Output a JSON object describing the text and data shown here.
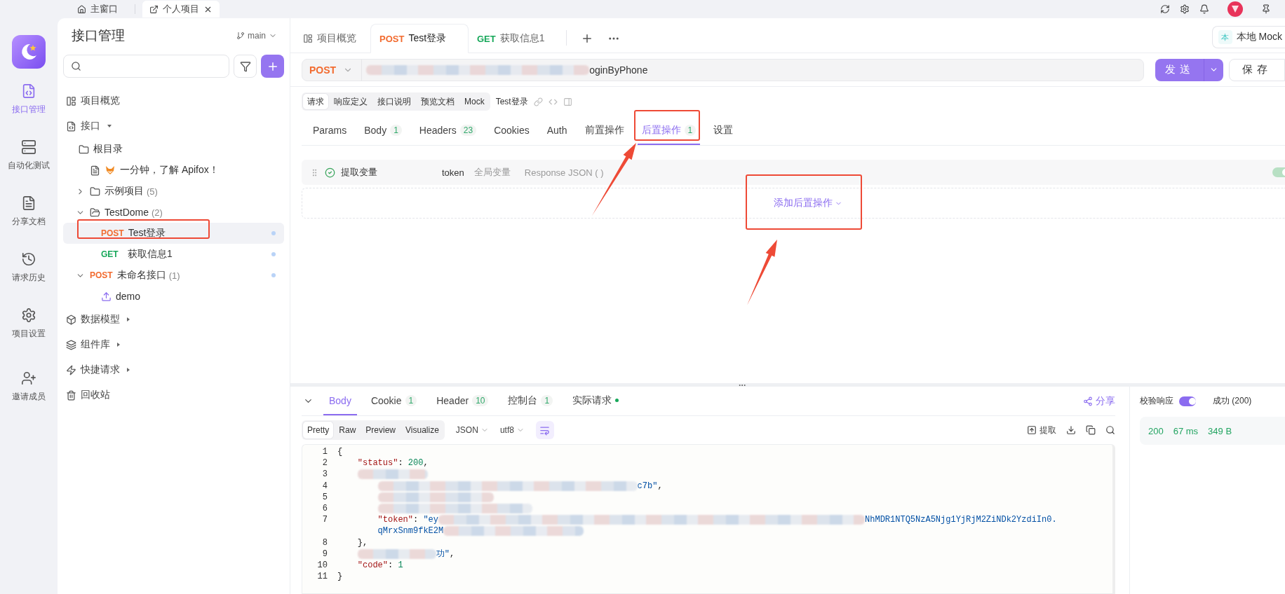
{
  "app_tabs": [
    {
      "kind": "home",
      "label": "主窗口",
      "selected": false
    },
    {
      "kind": "project",
      "label": "个人项目",
      "selected": true
    }
  ],
  "rail": [
    {
      "kind": "api",
      "label": "接口管理",
      "selected": true
    },
    {
      "kind": "test",
      "label": "自动化测试",
      "selected": false
    },
    {
      "kind": "docs",
      "label": "分享文档",
      "selected": false
    },
    {
      "kind": "history",
      "label": "请求历史",
      "selected": false
    },
    {
      "kind": "settings",
      "label": "项目设置",
      "selected": false
    },
    {
      "kind": "invite",
      "label": "邀请成员",
      "selected": false
    }
  ],
  "sidebar": {
    "title": "接口管理",
    "branch": "main",
    "sections": [
      {
        "kind": "overview",
        "label": "项目概览"
      },
      {
        "kind": "apis",
        "label": "接口",
        "expanded": true,
        "tree": [
          {
            "kind": "folder",
            "label": "根目录",
            "selected": false,
            "children": [
              {
                "kind": "doc",
                "label": "一分钟，了解 Apifox！",
                "selected": false
              },
              {
                "kind": "folder",
                "label": "示例项目",
                "count": "(5)",
                "expanded": false,
                "selected": false
              },
              {
                "kind": "folder",
                "label": "TestDome",
                "count": "(2)",
                "expanded": true,
                "selected": false,
                "children": [
                  {
                    "kind": "api",
                    "method": "POST",
                    "label": "Test登录",
                    "selected": true
                  },
                  {
                    "kind": "api",
                    "method": "GET",
                    "label": "获取信息1",
                    "selected": false
                  }
                ]
              },
              {
                "kind": "api",
                "method": "POST",
                "label": "未命名接口",
                "count": "(1)",
                "expanded": true,
                "selected": false,
                "children": [
                  {
                    "kind": "case",
                    "label": "demo",
                    "selected": false
                  }
                ]
              }
            ]
          }
        ]
      },
      {
        "kind": "models",
        "label": "数据模型",
        "expanded": false
      },
      {
        "kind": "components",
        "label": "组件库",
        "expanded": false
      },
      {
        "kind": "quick",
        "label": "快捷请求",
        "expanded": false
      },
      {
        "kind": "trash",
        "label": "回收站"
      }
    ]
  },
  "editor_tabs": [
    {
      "kind": "overview",
      "label": "项目概览",
      "selected": false
    },
    {
      "kind": "api",
      "method": "POST",
      "label": "Test登录",
      "selected": true
    },
    {
      "kind": "api",
      "method": "GET",
      "label": "获取信息1",
      "selected": false
    }
  ],
  "environment": {
    "badge": "本",
    "label": "本地 Mock"
  },
  "request": {
    "method": "POST",
    "url": "oginByPhone",
    "send": "发送",
    "save": "保存"
  },
  "view_tabs": [
    {
      "label": "请求",
      "selected": true
    },
    {
      "label": "响应定义",
      "selected": false
    },
    {
      "label": "接口说明",
      "selected": false
    },
    {
      "label": "预览文档",
      "selected": false
    },
    {
      "label": "Mock",
      "selected": false
    }
  ],
  "api_name": "Test登录",
  "param_tabs": [
    {
      "label": "Params",
      "selected": false
    },
    {
      "label": "Body",
      "count": "1",
      "selected": false
    },
    {
      "label": "Headers",
      "count": "23",
      "selected": false
    },
    {
      "label": "Cookies",
      "selected": false
    },
    {
      "label": "Auth",
      "selected": false
    },
    {
      "label": "前置操作",
      "selected": false
    },
    {
      "label": "后置操作",
      "count": "1",
      "selected": true
    },
    {
      "label": "设置",
      "selected": false
    }
  ],
  "post_operations": [
    {
      "name": "提取变量",
      "variable": "token",
      "scope": "全局变量",
      "source": "Response JSON ( )",
      "on": true
    }
  ],
  "add_operation": "添加后置操作",
  "response": {
    "tabs": [
      {
        "label": "Body",
        "selected": true
      },
      {
        "label": "Cookie",
        "count": "1",
        "selected": false
      },
      {
        "label": "Header",
        "count": "10",
        "selected": false
      },
      {
        "label": "控制台",
        "count": "1",
        "selected": false
      },
      {
        "label": "实际请求",
        "dot": true,
        "selected": false
      }
    ],
    "share": "分享",
    "formats": [
      {
        "label": "Pretty",
        "selected": true
      },
      {
        "label": "Raw",
        "selected": false
      },
      {
        "label": "Preview",
        "selected": false
      },
      {
        "label": "Visualize",
        "selected": false
      }
    ],
    "language": "JSON",
    "encoding": "utf8",
    "extract": "提取",
    "code": [
      {
        "number": "1",
        "tokens": [
          {
            "kind": "punct",
            "text": "{"
          }
        ]
      },
      {
        "number": "2",
        "tokens": [
          {
            "kind": "key",
            "text": "\"status\""
          },
          {
            "kind": "punct",
            "text": ": "
          },
          {
            "kind": "number",
            "text": "200"
          },
          {
            "kind": "punct",
            "text": ","
          }
        ]
      },
      {
        "number": "3",
        "tokens": [
          {
            "kind": "blur"
          }
        ]
      },
      {
        "number": "4",
        "tokens": [
          {
            "kind": "blur"
          },
          {
            "kind": "string",
            "text": "c7b\""
          },
          {
            "kind": "punct",
            "text": ","
          }
        ]
      },
      {
        "number": "5",
        "tokens": [
          {
            "kind": "blur"
          }
        ]
      },
      {
        "number": "6",
        "tokens": [
          {
            "kind": "blur"
          }
        ]
      },
      {
        "number": "7",
        "tokens": [
          {
            "kind": "key",
            "text": "\"token\""
          },
          {
            "kind": "punct",
            "text": ": "
          },
          {
            "kind": "string",
            "text": "\"ey"
          },
          {
            "kind": "blur"
          },
          {
            "kind": "string",
            "text": "NhMDR1NTQ5NzA5Njg1YjRjM2ZiNDk2YzdiIn0."
          }
        ],
        "wrap": [
          {
            "kind": "string",
            "text": "qMrxSnm9fkE2M"
          },
          {
            "kind": "blur"
          }
        ]
      },
      {
        "number": "8",
        "tokens": [
          {
            "kind": "punct",
            "text": "},"
          }
        ]
      },
      {
        "number": "9",
        "tokens": [
          {
            "kind": "blur"
          },
          {
            "kind": "string",
            "text": "功\""
          },
          {
            "kind": "punct",
            "text": ","
          }
        ]
      },
      {
        "number": "10",
        "tokens": [
          {
            "kind": "key",
            "text": "\"code\""
          },
          {
            "kind": "punct",
            "text": ": "
          },
          {
            "kind": "number",
            "text": "1"
          }
        ]
      },
      {
        "number": "11",
        "tokens": [
          {
            "kind": "punct",
            "text": "}"
          }
        ]
      }
    ]
  },
  "validation": {
    "label": "校验响应",
    "on": true,
    "result": "成功 (200)",
    "status": "200",
    "time": "67 ms",
    "size": "349 B"
  }
}
